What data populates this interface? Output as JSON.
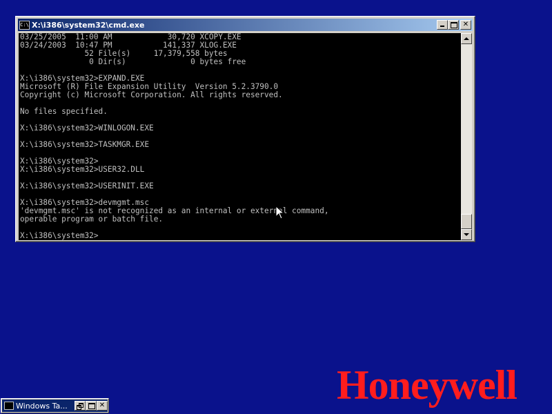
{
  "window": {
    "title": "X:\\i386\\system32\\cmd.exe",
    "system_icon": "cmd-console-icon",
    "system_icon_text": "C:\\",
    "minimize_icon": "minimize-icon",
    "maximize_icon": "maximize-icon",
    "close_label": "✕"
  },
  "console": {
    "lines": [
      "03/25/2005  11:00 AM            30,720 XCOPY.EXE",
      "03/24/2003  10:47 PM           141,337 XLOG.EXE",
      "              52 File(s)     17,379,558 bytes",
      "               0 Dir(s)              0 bytes free",
      "",
      "X:\\i386\\system32>EXPAND.EXE",
      "Microsoft (R) File Expansion Utility  Version 5.2.3790.0",
      "Copyright (c) Microsoft Corporation. All rights reserved.",
      "",
      "No files specified.",
      "",
      "X:\\i386\\system32>WINLOGON.EXE",
      "",
      "X:\\i386\\system32>TASKMGR.EXE",
      "",
      "X:\\i386\\system32>",
      "X:\\i386\\system32>USER32.DLL",
      "",
      "X:\\i386\\system32>USERINIT.EXE",
      "",
      "X:\\i386\\system32>devmgmt.msc",
      "'devmgmt.msc' is not recognized as an internal or external command,",
      "operable program or batch file.",
      "",
      "X:\\i386\\system32>"
    ]
  },
  "desktop": {
    "logo_text": "Honeywell",
    "logo_color": "#ff1d1d",
    "background_color": "#0a128c"
  },
  "taskbar": {
    "item_label": "Windows Ta...",
    "item_icon": "console-window-icon",
    "restore_icon": "restore-icon",
    "maximize_icon": "maximize-icon",
    "close_label": "✕"
  }
}
